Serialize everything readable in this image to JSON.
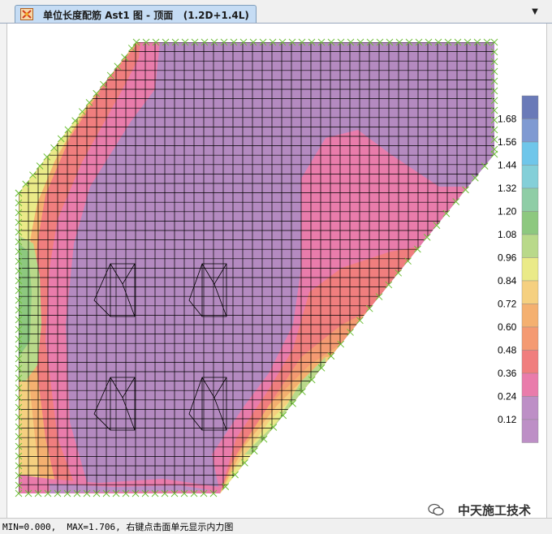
{
  "window": {
    "tab_title": "单位长度配筋 Ast1 图 - 顶面   (1.2D+1.4L)",
    "tab_icon": "app-logo-icon",
    "dropdown_icon": "chevron-down-icon"
  },
  "legend": {
    "values": [
      "1.68",
      "1.56",
      "1.44",
      "1.32",
      "1.20",
      "1.08",
      "0.96",
      "0.84",
      "0.72",
      "0.60",
      "0.48",
      "0.36",
      "0.24",
      "0.12"
    ],
    "colors": [
      "#6a7ab8",
      "#7f9ad2",
      "#6fc6ea",
      "#84cfd8",
      "#8fcda6",
      "#8dc87f",
      "#b9d98a",
      "#eaea88",
      "#f5d080",
      "#f4b070",
      "#f49a72",
      "#f07e7e",
      "#e97cab",
      "#bd8fc6"
    ]
  },
  "status": {
    "text": "MIN=0.000,  MAX=1.706, 右键点击面单元显示内力图"
  },
  "watermark": {
    "text": "中天施工技术"
  }
}
